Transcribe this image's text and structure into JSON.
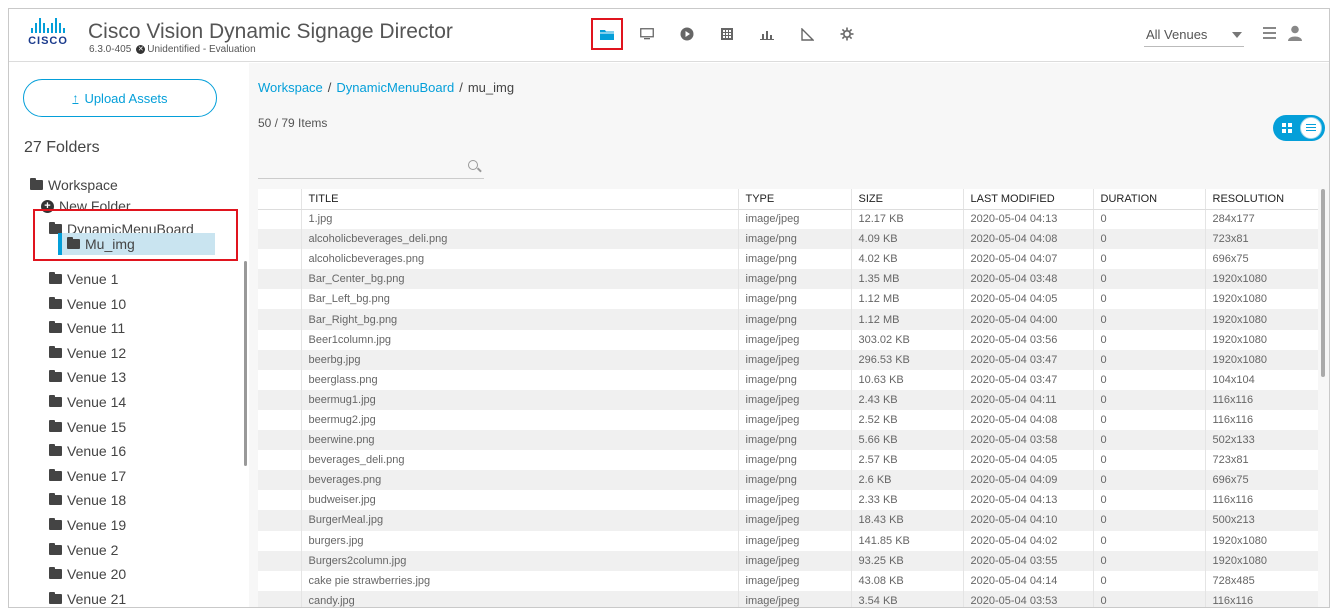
{
  "app": {
    "title": "Cisco Vision Dynamic Signage Director",
    "version": "6.3.0-405",
    "license": "Unidentified - Evaluation",
    "logo_text": "CISCO",
    "accent_color": "#049fd9"
  },
  "nav": {
    "icons": [
      "folder-icon",
      "display-icon",
      "play-icon",
      "calendar-icon",
      "chart-icon",
      "ruler-icon",
      "gear-icon"
    ],
    "active": "folder-icon"
  },
  "venue_select": {
    "value": "All Venues"
  },
  "sidebar": {
    "upload_label": "Upload Assets",
    "upload_arrow": "↑",
    "folder_count": "27 Folders",
    "workspace": "Workspace",
    "new_folder": "New Folder",
    "dynamic_menu_board": "DynamicMenuBoard",
    "selected_folder": "Mu_img",
    "venues": [
      "Venue 1",
      "Venue 10",
      "Venue 11",
      "Venue 12",
      "Venue 13",
      "Venue 14",
      "Venue 15",
      "Venue 16",
      "Venue 17",
      "Venue 18",
      "Venue 19",
      "Venue 2",
      "Venue 20",
      "Venue 21"
    ]
  },
  "breadcrumb": {
    "root": "Workspace",
    "parent": "DynamicMenuBoard",
    "current": "mu_img",
    "sep": "/"
  },
  "items_count": "50 / 79 Items",
  "search": {
    "value": "",
    "placeholder": ""
  },
  "table": {
    "columns": [
      "TITLE",
      "TYPE",
      "SIZE",
      "LAST MODIFIED",
      "DURATION",
      "RESOLUTION"
    ],
    "rows": [
      [
        "1.jpg",
        "image/jpeg",
        "12.17 KB",
        "2020-05-04 04:13",
        "0",
        "284x177"
      ],
      [
        "alcoholicbeverages_deli.png",
        "image/png",
        "4.09 KB",
        "2020-05-04 04:08",
        "0",
        "723x81"
      ],
      [
        "alcoholicbeverages.png",
        "image/png",
        "4.02 KB",
        "2020-05-04 04:07",
        "0",
        "696x75"
      ],
      [
        "Bar_Center_bg.png",
        "image/png",
        "1.35 MB",
        "2020-05-04 03:48",
        "0",
        "1920x1080"
      ],
      [
        "Bar_Left_bg.png",
        "image/png",
        "1.12 MB",
        "2020-05-04 04:05",
        "0",
        "1920x1080"
      ],
      [
        "Bar_Right_bg.png",
        "image/png",
        "1.12 MB",
        "2020-05-04 04:00",
        "0",
        "1920x1080"
      ],
      [
        "Beer1column.jpg",
        "image/jpeg",
        "303.02 KB",
        "2020-05-04 03:56",
        "0",
        "1920x1080"
      ],
      [
        "beerbg.jpg",
        "image/jpeg",
        "296.53 KB",
        "2020-05-04 03:47",
        "0",
        "1920x1080"
      ],
      [
        "beerglass.png",
        "image/png",
        "10.63 KB",
        "2020-05-04 03:47",
        "0",
        "104x104"
      ],
      [
        "beermug1.jpg",
        "image/jpeg",
        "2.43 KB",
        "2020-05-04 04:11",
        "0",
        "116x116"
      ],
      [
        "beermug2.jpg",
        "image/jpeg",
        "2.52 KB",
        "2020-05-04 04:08",
        "0",
        "116x116"
      ],
      [
        "beerwine.png",
        "image/png",
        "5.66 KB",
        "2020-05-04 03:58",
        "0",
        "502x133"
      ],
      [
        "beverages_deli.png",
        "image/png",
        "2.57 KB",
        "2020-05-04 04:05",
        "0",
        "723x81"
      ],
      [
        "beverages.png",
        "image/png",
        "2.6 KB",
        "2020-05-04 04:09",
        "0",
        "696x75"
      ],
      [
        "budweiser.jpg",
        "image/jpeg",
        "2.33 KB",
        "2020-05-04 04:13",
        "0",
        "116x116"
      ],
      [
        "BurgerMeal.jpg",
        "image/jpeg",
        "18.43 KB",
        "2020-05-04 04:10",
        "0",
        "500x213"
      ],
      [
        "burgers.jpg",
        "image/jpeg",
        "141.85 KB",
        "2020-05-04 04:02",
        "0",
        "1920x1080"
      ],
      [
        "Burgers2column.jpg",
        "image/jpeg",
        "93.25 KB",
        "2020-05-04 03:55",
        "0",
        "1920x1080"
      ],
      [
        "cake pie strawberries.jpg",
        "image/jpeg",
        "43.08 KB",
        "2020-05-04 04:14",
        "0",
        "728x485"
      ],
      [
        "candy.jpg",
        "image/jpeg",
        "3.54 KB",
        "2020-05-04 03:53",
        "0",
        "116x116"
      ]
    ]
  }
}
